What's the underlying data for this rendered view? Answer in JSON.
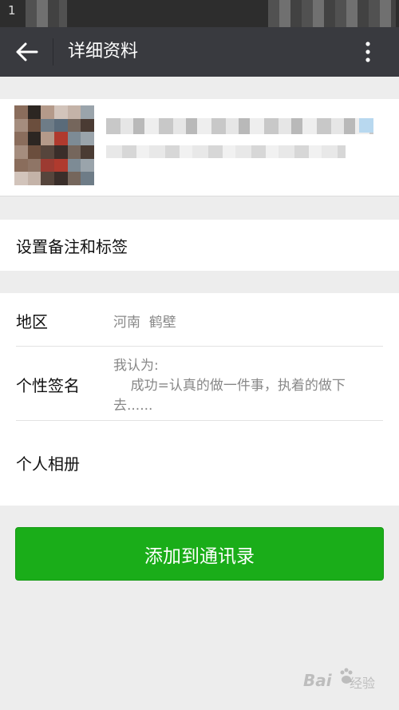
{
  "status_bar": {
    "time": "1"
  },
  "header": {
    "title": "详细资料",
    "back_icon": "arrow-left-icon",
    "menu_icon": "more-vertical-icon"
  },
  "remark": {
    "label": "设置备注和标签"
  },
  "details": {
    "region": {
      "label": "地区",
      "value": "河南  鹤壁"
    },
    "signature": {
      "label": "个性签名",
      "lines": [
        "我认为:",
        "    成功=认真的做一件事，执着的做下",
        "去......"
      ]
    },
    "album": {
      "label": "个人相册"
    }
  },
  "actions": {
    "add_label": "添加到通讯录"
  },
  "watermark": {
    "text": "Bai",
    "suffix": "经验"
  },
  "colors": {
    "app_bar": "#393a3f",
    "primary_button": "#1aad19",
    "background": "#ededed"
  }
}
